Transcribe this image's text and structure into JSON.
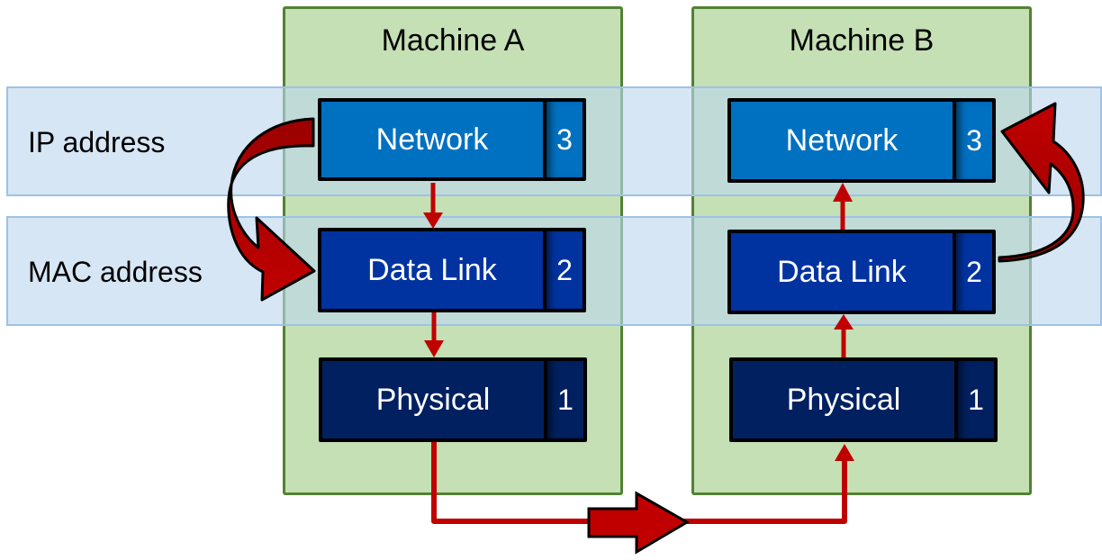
{
  "machines": [
    {
      "title": "Machine A"
    },
    {
      "title": "Machine B"
    }
  ],
  "bands": [
    {
      "label": "IP address"
    },
    {
      "label": "MAC address"
    }
  ],
  "layers": {
    "network": {
      "name": "Network",
      "number": "3"
    },
    "data_link": {
      "name": "Data Link",
      "number": "2"
    },
    "physical": {
      "name": "Physical",
      "number": "1"
    }
  },
  "colors": {
    "machine_fill": "#c5e0b4",
    "machine_border": "#538135",
    "band_fill": "#bdd7ee",
    "network": "#0070c0",
    "data_link": "#0033a0",
    "physical": "#002060",
    "arrow": "#c00000"
  }
}
